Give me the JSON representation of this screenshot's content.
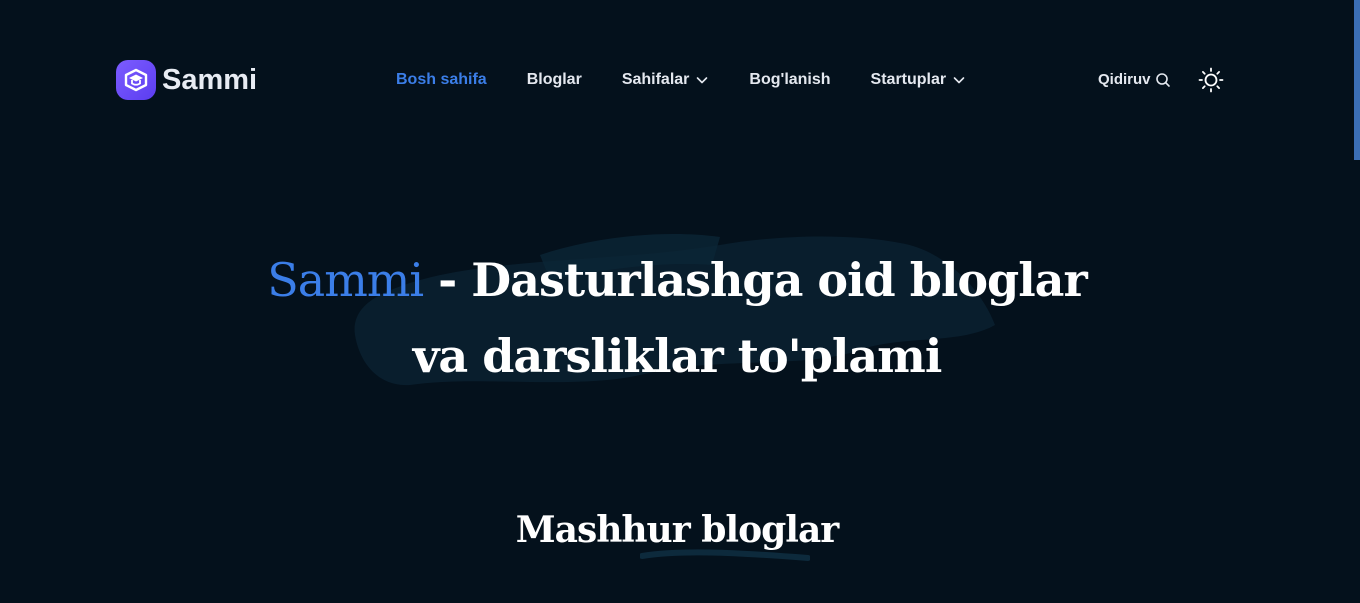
{
  "brand": {
    "name": "Sammi",
    "icon": "graduation-cap-icon",
    "color": "#6c4ef5"
  },
  "nav": {
    "items": [
      {
        "label": "Bosh sahifa",
        "active": true
      },
      {
        "label": "Bloglar",
        "active": false
      },
      {
        "label": "Sahifalar",
        "active": false,
        "dropdown": true
      },
      {
        "label": "Bog'lanish",
        "active": false
      },
      {
        "label": "Startuplar",
        "active": false,
        "dropdown": true
      }
    ]
  },
  "tools": {
    "search_label": "Qidiruv",
    "search_icon": "search-icon",
    "theme_icon": "sun-icon"
  },
  "hero": {
    "title_accent": "Sammi",
    "title_rest_line1": " - Dasturlashga oid bloglar",
    "title_line2": "va darsliklar to'plami"
  },
  "section": {
    "title": "Mashhur bloglar"
  },
  "colors": {
    "background": "#04111c",
    "accent": "#3b7ee8",
    "text": "#ffffff"
  }
}
